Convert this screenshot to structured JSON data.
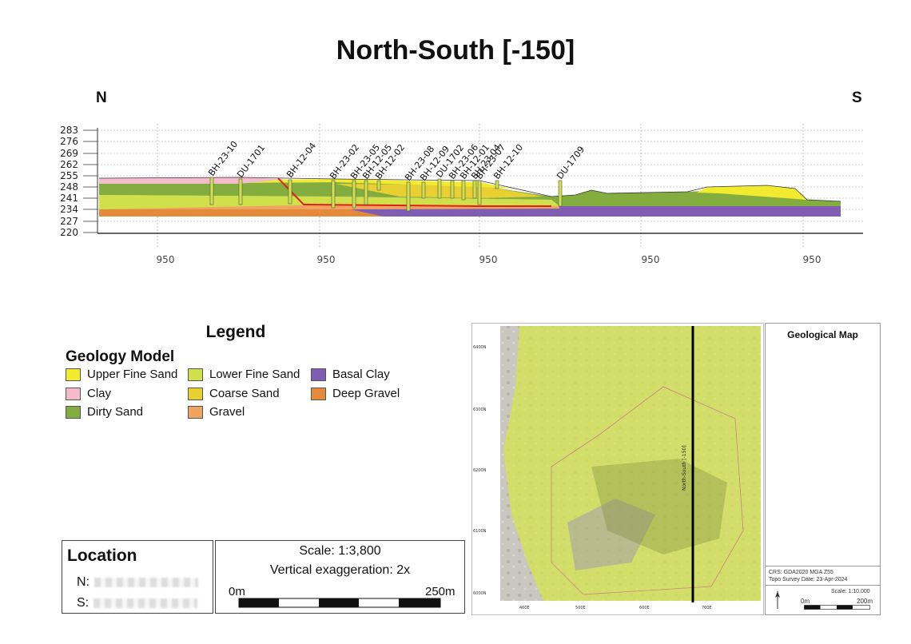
{
  "title": "North-South [-150]",
  "directions": {
    "north": "N",
    "south": "S"
  },
  "section": {
    "y_ticks": [
      "283",
      "276",
      "269",
      "262",
      "255",
      "248",
      "241",
      "234",
      "227",
      "220"
    ],
    "x_ticks": [
      "950",
      "950",
      "950",
      "950",
      "950"
    ],
    "boreholes": [
      "BH-23-10",
      "DU-1701",
      "BH-12-04",
      "BH-23-02",
      "BH-23-05",
      "BH-12-05",
      "BH-12-02",
      "BH-23-08",
      "BH-12-09",
      "DU-1702",
      "BH-23-06",
      "BH-12-01",
      "BH-23-04",
      "BH-23-07",
      "BH-12-10",
      "DU-1709"
    ]
  },
  "legend": {
    "title": "Legend",
    "subtitle": "Geology Model",
    "items": [
      {
        "label": "Upper Fine Sand",
        "color": "#f2ea2e"
      },
      {
        "label": "Clay",
        "color": "#f4bccb"
      },
      {
        "label": "Dirty Sand",
        "color": "#83ad3f"
      },
      {
        "label": "Lower Fine Sand",
        "color": "#cfe04a"
      },
      {
        "label": "Coarse Sand",
        "color": "#e8cf32"
      },
      {
        "label": "Gravel",
        "color": "#f0a35f"
      },
      {
        "label": "Basal Clay",
        "color": "#7f5db2"
      },
      {
        "label": "Deep Gravel",
        "color": "#e38b3b"
      }
    ]
  },
  "location": {
    "title": "Location",
    "north_label": "N:",
    "south_label": "S:"
  },
  "scale": {
    "scale_text": "Scale: 1:3,800",
    "vex_text": "Vertical exaggeration: 2x",
    "start": "0m",
    "end": "250m"
  },
  "map": {
    "title": "Geological Map",
    "section_label": "North-South [-150]",
    "crs": "CRS: GDA2020 MGA Z55",
    "topo": "Topo Survey Date: 23-Apr-2024",
    "scale": "Scale: 1:10,000",
    "sb_start": "0m",
    "sb_end": "200m",
    "y_ticks": [
      "6400N",
      "6300N",
      "6200N",
      "6100N",
      "6000N"
    ],
    "x_ticks": [
      "400E",
      "500E",
      "600E",
      "700E"
    ]
  }
}
